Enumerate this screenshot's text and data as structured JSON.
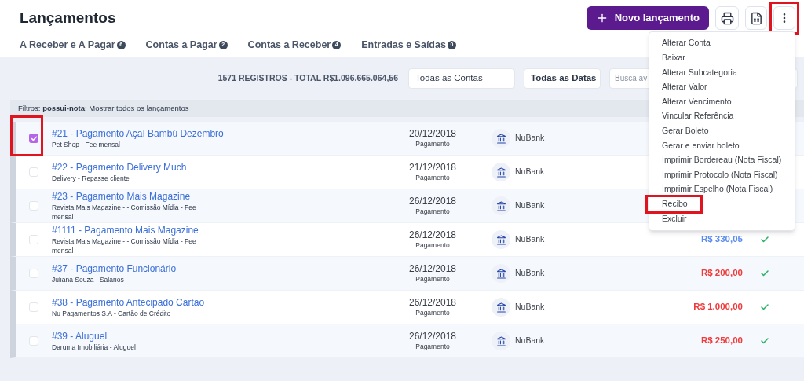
{
  "page": {
    "title": "Lançamentos"
  },
  "actions": {
    "new_button": "Novo lançamento",
    "more_annotated": true
  },
  "tabs": [
    {
      "label": "A Receber e A Pagar",
      "count": "6"
    },
    {
      "label": "Contas a Pagar",
      "count": "2"
    },
    {
      "label": "Contas a Receber",
      "count": "4"
    },
    {
      "label": "Entradas e Saídas",
      "count": "0"
    }
  ],
  "toolbar": {
    "summary": "1571 REGISTROS - TOTAL R$1.096.665.064,56",
    "account_select": "Todas as Contas",
    "date_select": "Todas as Datas",
    "search_placeholder": "Busca av"
  },
  "filter": {
    "text": "Filtros: **possui-nota**: Mostrar todos os lançamentos"
  },
  "rows": [
    {
      "title": "#21 - Pagamento Açaí Bambú Dezembro",
      "subtitle": "Pet Shop - Fee mensal",
      "date": "20/12/2018",
      "type": "Pagamento",
      "bank": "NuBank",
      "checked": true,
      "annotated": true
    },
    {
      "title": "#22 - Pagamento Delivery Much",
      "subtitle": "Delivery - Repasse cliente",
      "date": "21/12/2018",
      "type": "Pagamento",
      "bank": "NuBank",
      "checked": false,
      "annotated": false
    },
    {
      "title": "#23 - Pagamento Mais Magazine",
      "subtitle": "Revista Mais Magazine - - Comissão Mídia - Fee mensal",
      "date": "26/12/2018",
      "type": "Pagamento",
      "bank": "NuBank",
      "checked": false,
      "annotated": false
    },
    {
      "title": "#1111 - Pagamento Mais Magazine",
      "subtitle": "Revista Mais Magazine - - Comissão Mídia - Fee mensal",
      "date": "26/12/2018",
      "type": "Pagamento",
      "bank": "NuBank",
      "checked": false,
      "annotated": false,
      "value": "R$ 330,05",
      "color": "#5b8def",
      "paid": true
    },
    {
      "title": "#37 - Pagamento Funcionário",
      "subtitle": "Juliana Souza - Salários",
      "date": "26/12/2018",
      "type": "Pagamento",
      "bank": "NuBank",
      "checked": false,
      "annotated": false,
      "value": "R$ 200,00",
      "color": "#ef3b3b",
      "paid": true
    },
    {
      "title": "#38 - Pagamento Antecipado Cartão",
      "subtitle": "Nu Pagamentos S.A - Cartão de Crédito",
      "date": "26/12/2018",
      "type": "Pagamento",
      "bank": "NuBank",
      "checked": false,
      "annotated": false,
      "value": "R$ 1.000,00",
      "color": "#ef3b3b",
      "paid": true
    },
    {
      "title": "#39 - Aluguel",
      "subtitle": "Daruma Imobiliária - Aluguel",
      "date": "26/12/2018",
      "type": "Pagamento",
      "bank": "NuBank",
      "checked": false,
      "annotated": false,
      "value": "R$ 250,00",
      "color": "#ef3b3b",
      "paid": true
    }
  ],
  "menu": [
    {
      "label": "Alterar Conta",
      "annotated": false
    },
    {
      "label": "Baixar",
      "annotated": false
    },
    {
      "label": "Alterar Subcategoria",
      "annotated": false
    },
    {
      "label": "Alterar Valor",
      "annotated": false
    },
    {
      "label": "Alterar Vencimento",
      "annotated": false
    },
    {
      "label": "Vincular Referência",
      "annotated": false
    },
    {
      "label": "Gerar Boleto",
      "annotated": false
    },
    {
      "label": "Gerar e enviar boleto",
      "annotated": false
    },
    {
      "label": "Imprimir Bordereau (Nota Fiscal)",
      "annotated": false
    },
    {
      "label": "Imprimir Protocolo (Nota Fiscal)",
      "annotated": false
    },
    {
      "label": "Imprimir Espelho (Nota Fiscal)",
      "annotated": false
    },
    {
      "label": "Recibo",
      "annotated": true
    },
    {
      "label": "Excluir",
      "annotated": false
    }
  ]
}
